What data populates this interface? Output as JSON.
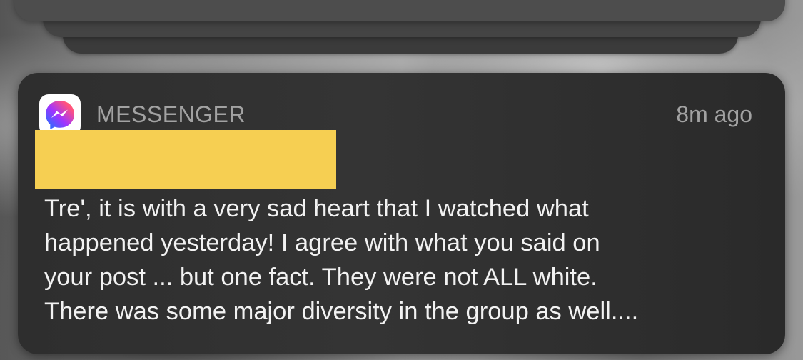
{
  "notification": {
    "app_name": "MESSENGER",
    "timestamp": "8m ago",
    "app_icon": "messenger-icon",
    "redaction_color": "#f6cf52",
    "message": "Tre', it is with a very sad heart that I watched what\nhappened yesterday!  I agree with what you said on\nyour post ... but one fact.  They were not ALL white.\nThere was some major diversity in the group as well...."
  }
}
